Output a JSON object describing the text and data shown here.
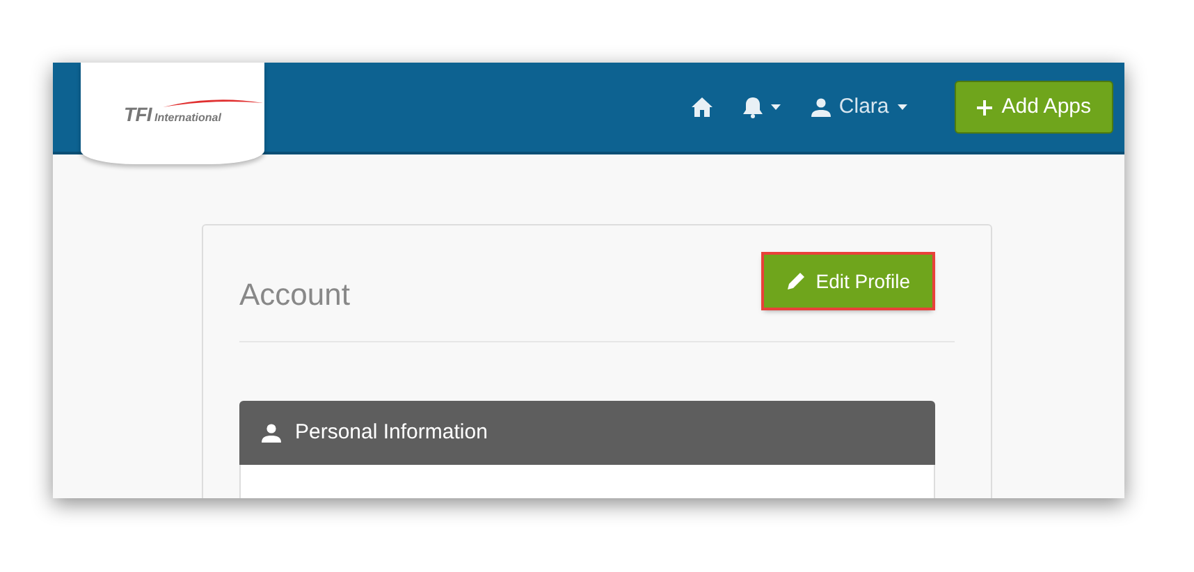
{
  "header": {
    "logo": {
      "mark": "TFI",
      "word": "International"
    },
    "nav": [
      {
        "kind": "home"
      },
      {
        "kind": "notifications",
        "dropdown": true
      },
      {
        "kind": "user",
        "label": "Clara",
        "dropdown": true
      }
    ],
    "add_button": {
      "label": "Add Apps"
    }
  },
  "account": {
    "title": "Account",
    "edit_button": {
      "label": "Edit Profile",
      "highlighted": true
    },
    "panel": {
      "title": "Personal Information"
    }
  }
}
